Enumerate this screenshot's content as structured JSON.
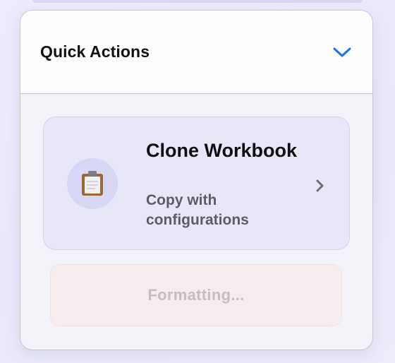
{
  "panel": {
    "title": "Quick Actions",
    "toggle_icon": "chevron-down-icon",
    "accent": "#1a73e8"
  },
  "action": {
    "title": "Clone Workbook",
    "subtitle": "Copy with configurations",
    "icon": "clipboard-icon",
    "arrow_icon": "chevron-right-icon"
  },
  "status": {
    "label": "Formatting..."
  }
}
